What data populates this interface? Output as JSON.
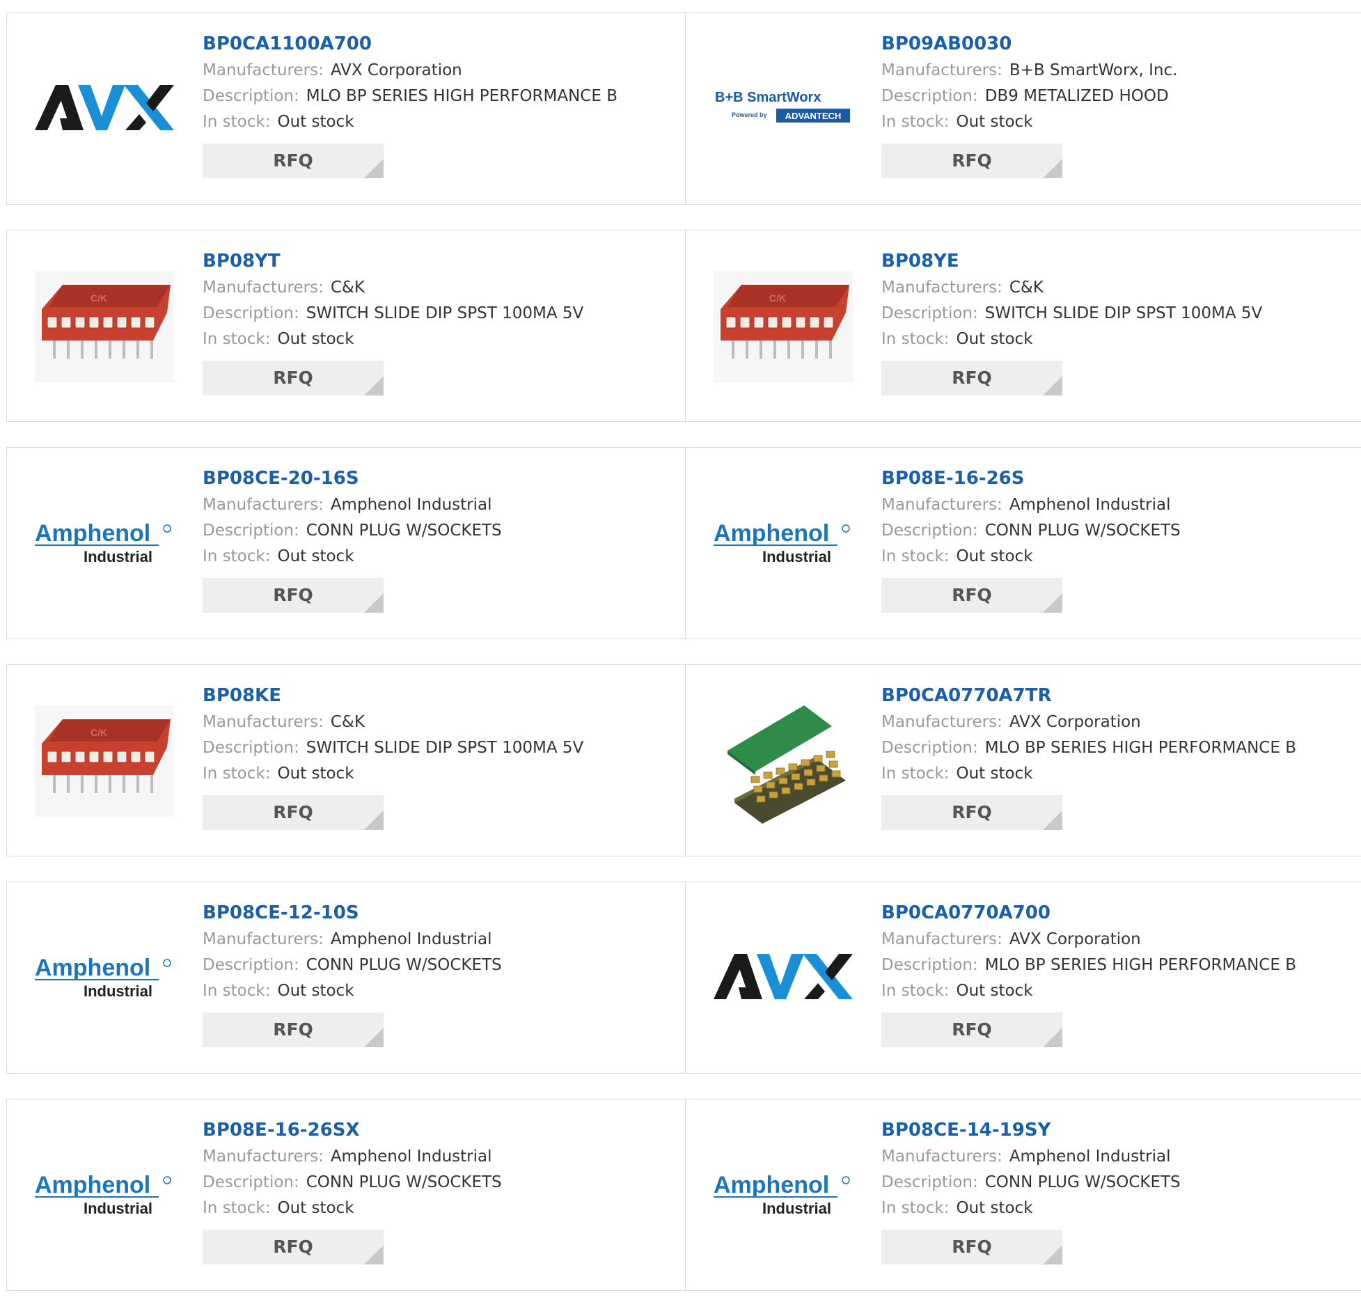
{
  "labels": {
    "manufacturers": "Manufacturers:",
    "description": "Description:",
    "in_stock": "In stock:",
    "rfq": "RFQ"
  },
  "logos": {
    "avx": "AVX",
    "bb_top": "B+B SmartWorx",
    "bb_powered": "Powered by",
    "bb_advantech": "ADVANTECH",
    "amphenol": "Amphenol",
    "amphenol_sub": "Industrial",
    "ck_mark": "C/K"
  },
  "rows": [
    [
      {
        "part": "BP0CA1100A700",
        "manufacturer": "AVX Corporation",
        "description": "MLO BP SERIES HIGH PERFORMANCE B",
        "stock": "Out stock",
        "image": "avx-logo"
      },
      {
        "part": "BP09AB0030",
        "manufacturer": "B+B SmartWorx, Inc.",
        "description": "DB9 METALIZED HOOD",
        "stock": "Out stock",
        "image": "bb-smartworx-logo"
      }
    ],
    [
      {
        "part": "BP08YT",
        "manufacturer": "C&K",
        "description": "SWITCH SLIDE DIP SPST 100MA 5V",
        "stock": "Out stock",
        "image": "dip-switch-photo"
      },
      {
        "part": "BP08YE",
        "manufacturer": "C&K",
        "description": "SWITCH SLIDE DIP SPST 100MA 5V",
        "stock": "Out stock",
        "image": "dip-switch-photo"
      }
    ],
    [
      {
        "part": "BP08CE-20-16S",
        "manufacturer": "Amphenol Industrial",
        "description": "CONN PLUG W/SOCKETS",
        "stock": "Out stock",
        "image": "amphenol-logo"
      },
      {
        "part": "BP08E-16-26S",
        "manufacturer": "Amphenol Industrial",
        "description": "CONN PLUG W/SOCKETS",
        "stock": "Out stock",
        "image": "amphenol-logo"
      }
    ],
    [
      {
        "part": "BP08KE",
        "manufacturer": "C&K",
        "description": "SWITCH SLIDE DIP SPST 100MA 5V",
        "stock": "Out stock",
        "image": "dip-switch-photo"
      },
      {
        "part": "BP0CA0770A7TR",
        "manufacturer": "AVX Corporation",
        "description": "MLO BP SERIES HIGH PERFORMANCE B",
        "stock": "Out stock",
        "image": "mlo-chip-photo"
      }
    ],
    [
      {
        "part": "BP08CE-12-10S",
        "manufacturer": "Amphenol Industrial",
        "description": "CONN PLUG W/SOCKETS",
        "stock": "Out stock",
        "image": "amphenol-logo"
      },
      {
        "part": "BP0CA0770A700",
        "manufacturer": "AVX Corporation",
        "description": "MLO BP SERIES HIGH PERFORMANCE B",
        "stock": "Out stock",
        "image": "avx-logo"
      }
    ],
    [
      {
        "part": "BP08E-16-26SX",
        "manufacturer": "Amphenol Industrial",
        "description": "CONN PLUG W/SOCKETS",
        "stock": "Out stock",
        "image": "amphenol-logo"
      },
      {
        "part": "BP08CE-14-19SY",
        "manufacturer": "Amphenol Industrial",
        "description": "CONN PLUG W/SOCKETS",
        "stock": "Out stock",
        "image": "amphenol-logo"
      }
    ]
  ],
  "colors": {
    "part_link": "#1a5fa8",
    "label": "#999999",
    "value": "#333333",
    "rfq_bg": "#eeeeee",
    "avx_blue": "#1a8fd6",
    "amphenol_blue": "#1b75bc",
    "dip_red": "#c8402f",
    "pcb_green": "#2e8b4a"
  }
}
